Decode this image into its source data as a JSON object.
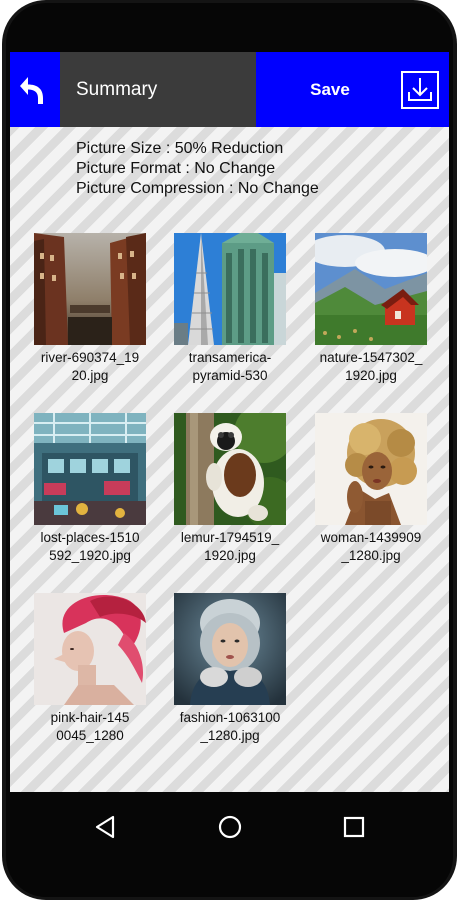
{
  "header": {
    "title": "Summary",
    "save_label": "Save",
    "back_icon": "back-arrow-icon",
    "download_icon": "download-tray-icon",
    "bar_color": "#0000ff",
    "title_bg_color": "#3b3b3b"
  },
  "summary": {
    "size": "Picture Size : 50% Reduction",
    "format": "Picture Format : No Change",
    "compression": "Picture Compression : No Change"
  },
  "files": [
    {
      "name_line1": "river-690374_19",
      "name_line2": "20.jpg"
    },
    {
      "name_line1": "transamerica-",
      "name_line2": "pyramid-530"
    },
    {
      "name_line1": "nature-1547302_",
      "name_line2": "1920.jpg"
    },
    {
      "name_line1": "lost-places-1510",
      "name_line2": "592_1920.jpg"
    },
    {
      "name_line1": "lemur-1794519_",
      "name_line2": "1920.jpg"
    },
    {
      "name_line1": "woman-1439909",
      "name_line2": "_1280.jpg"
    },
    {
      "name_line1": "pink-hair-145",
      "name_line2": "0045_1280"
    },
    {
      "name_line1": "fashion-1063100",
      "name_line2": "_1280.jpg"
    }
  ],
  "navbar": {
    "back_icon": "nav-back-triangle-icon",
    "home_icon": "nav-home-circle-icon",
    "recents_icon": "nav-recents-square-icon"
  }
}
